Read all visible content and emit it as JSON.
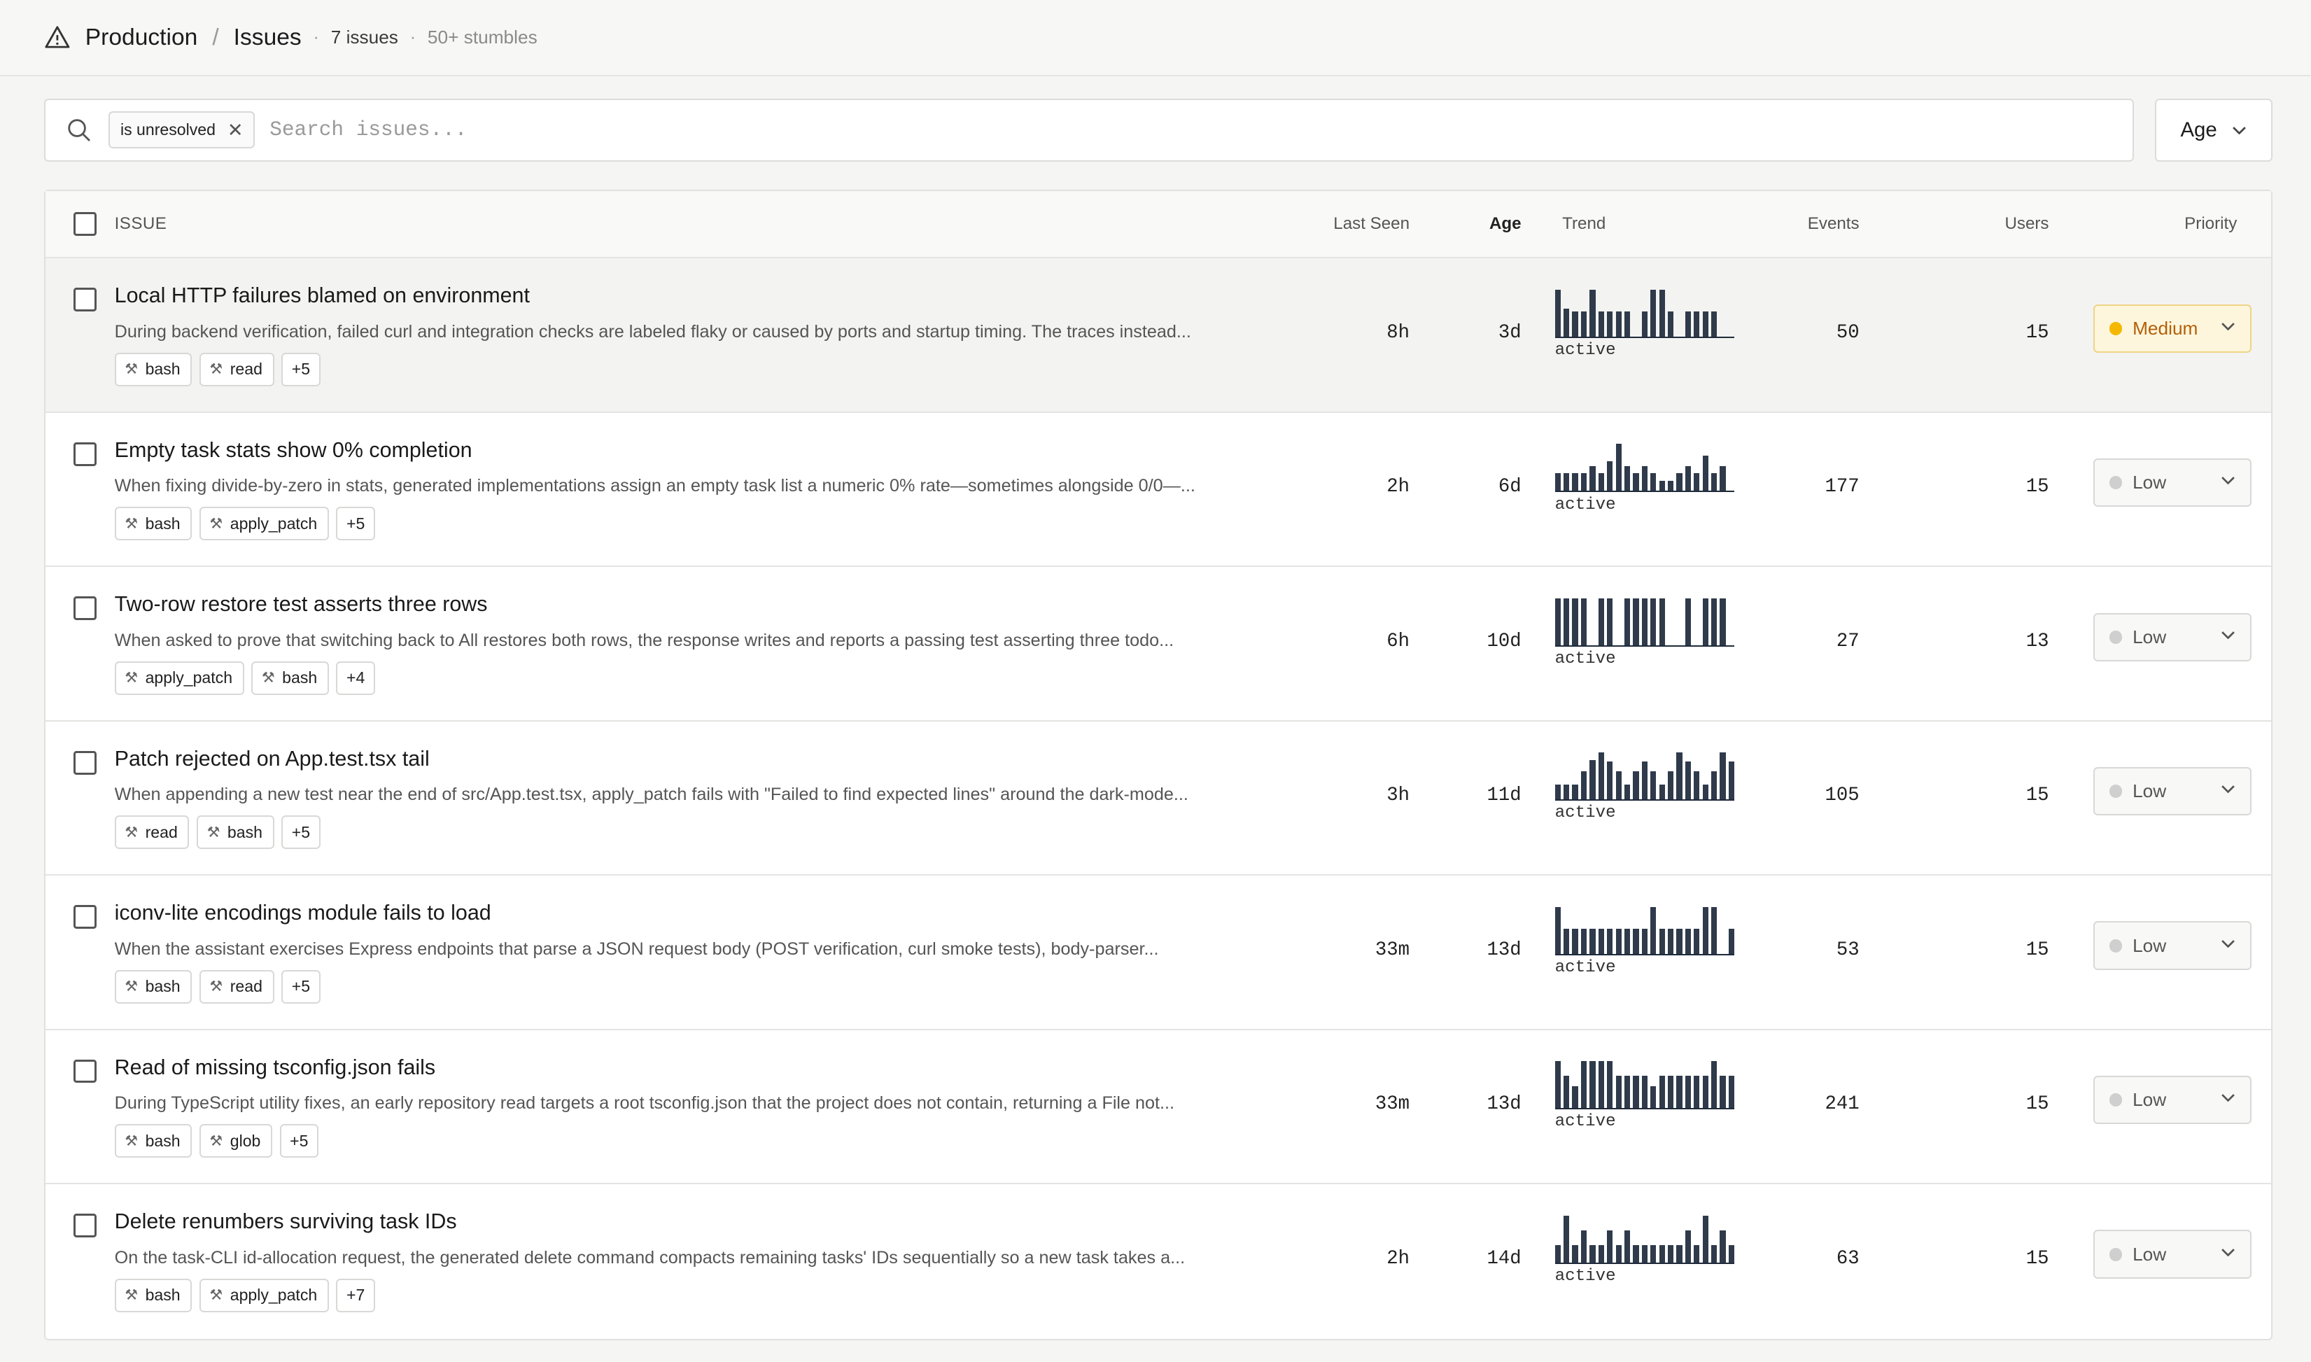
{
  "header": {
    "project": "Production",
    "section": "Issues",
    "count": "7 issues",
    "stumbles": "50+ stumbles"
  },
  "toolbar": {
    "filter_chip": "is unresolved",
    "search_placeholder": "Search issues...",
    "sort_label": "Age"
  },
  "columns": {
    "issue": "ISSUE",
    "last_seen": "Last Seen",
    "age": "Age",
    "trend": "Trend",
    "events": "Events",
    "users": "Users",
    "priority": "Priority"
  },
  "issues": [
    {
      "title": "Local HTTP failures blamed on environment",
      "description": "During backend verification, failed curl and integration checks are labeled flaky or caused by ports and startup timing. The traces instead...",
      "tags": [
        "bash",
        "read"
      ],
      "more": "+5",
      "last_seen": "8h",
      "age": "3d",
      "trend_label": "active",
      "trend": [
        0.95,
        0.55,
        0.5,
        0.5,
        0.95,
        0.5,
        0.5,
        0.5,
        0.5,
        0,
        0.5,
        0.95,
        0.95,
        0.5,
        0,
        0.5,
        0.5,
        0.5,
        0.5,
        0,
        0
      ],
      "events": "50",
      "users": "15",
      "priority": "Medium",
      "priority_color": "#f5b800",
      "highlight": true
    },
    {
      "title": "Empty task stats show 0% completion",
      "description": "When fixing divide-by-zero in stats, generated implementations assign an empty task list a numeric 0% rate—sometimes alongside 0/0—...",
      "tags": [
        "bash",
        "apply_patch"
      ],
      "more": "+5",
      "last_seen": "2h",
      "age": "6d",
      "trend_label": "active",
      "trend": [
        0.35,
        0.35,
        0.35,
        0.35,
        0.5,
        0.35,
        0.6,
        0.95,
        0.5,
        0.35,
        0.5,
        0.35,
        0.2,
        0.2,
        0.35,
        0.5,
        0.35,
        0.7,
        0.35,
        0.5,
        0
      ],
      "events": "177",
      "users": "15",
      "priority": "Low",
      "priority_color": "#cfcfcf",
      "highlight": false
    },
    {
      "title": "Two-row restore test asserts three rows",
      "description": "When asked to prove that switching back to All restores both rows, the response writes and reports a passing test asserting three todo...",
      "tags": [
        "apply_patch",
        "bash"
      ],
      "more": "+4",
      "last_seen": "6h",
      "age": "10d",
      "trend_label": "active",
      "trend": [
        0.95,
        0.95,
        0.95,
        0.95,
        0,
        0.95,
        0.95,
        0,
        0.95,
        0.95,
        0.95,
        0.95,
        0.95,
        0,
        0,
        0.95,
        0,
        0.95,
        0.95,
        0.95,
        0
      ],
      "events": "27",
      "users": "13",
      "priority": "Low",
      "priority_color": "#cfcfcf",
      "highlight": false
    },
    {
      "title": "Patch rejected on App.test.tsx tail",
      "description": "When appending a new test near the end of src/App.test.tsx, apply_patch fails with \"Failed to find expected lines\" around the dark-mode...",
      "tags": [
        "read",
        "bash"
      ],
      "more": "+5",
      "last_seen": "3h",
      "age": "11d",
      "trend_label": "active",
      "trend": [
        0.3,
        0.3,
        0.3,
        0.55,
        0.8,
        0.95,
        0.75,
        0.55,
        0.3,
        0.55,
        0.75,
        0.55,
        0.3,
        0.55,
        0.95,
        0.75,
        0.55,
        0.3,
        0.55,
        0.95,
        0.75
      ],
      "events": "105",
      "users": "15",
      "priority": "Low",
      "priority_color": "#cfcfcf",
      "highlight": false
    },
    {
      "title": "iconv-lite encodings module fails to load",
      "description": "When the assistant exercises Express endpoints that parse a JSON request body (POST verification, curl smoke tests), body-parser...",
      "tags": [
        "bash",
        "read"
      ],
      "more": "+5",
      "last_seen": "33m",
      "age": "13d",
      "trend_label": "active",
      "trend": [
        0.95,
        0.5,
        0.5,
        0.5,
        0.5,
        0.5,
        0.5,
        0.5,
        0.5,
        0.5,
        0.5,
        0.95,
        0.5,
        0.5,
        0.5,
        0.5,
        0.5,
        0.95,
        0.95,
        0,
        0.5
      ],
      "events": "53",
      "users": "15",
      "priority": "Low",
      "priority_color": "#cfcfcf",
      "highlight": false
    },
    {
      "title": "Read of missing tsconfig.json fails",
      "description": "During TypeScript utility fixes, an early repository read targets a root tsconfig.json that the project does not contain, returning a File not...",
      "tags": [
        "bash",
        "glob"
      ],
      "more": "+5",
      "last_seen": "33m",
      "age": "13d",
      "trend_label": "active",
      "trend": [
        0.95,
        0.65,
        0.45,
        0.95,
        0.95,
        0.95,
        0.95,
        0.65,
        0.65,
        0.65,
        0.65,
        0.45,
        0.65,
        0.65,
        0.65,
        0.65,
        0.65,
        0.65,
        0.95,
        0.65,
        0.65
      ],
      "events": "241",
      "users": "15",
      "priority": "Low",
      "priority_color": "#cfcfcf",
      "highlight": false
    },
    {
      "title": "Delete renumbers surviving task IDs",
      "description": "On the task-CLI id-allocation request, the generated delete command compacts remaining tasks' IDs sequentially so a new task takes a...",
      "tags": [
        "bash",
        "apply_patch"
      ],
      "more": "+7",
      "last_seen": "2h",
      "age": "14d",
      "trend_label": "active",
      "trend": [
        0.35,
        0.95,
        0.35,
        0.65,
        0.35,
        0.35,
        0.65,
        0.35,
        0.65,
        0.35,
        0.35,
        0.35,
        0.35,
        0.35,
        0.35,
        0.65,
        0.35,
        0.95,
        0.35,
        0.65,
        0.35
      ],
      "events": "63",
      "users": "15",
      "priority": "Low",
      "priority_color": "#cfcfcf",
      "highlight": false
    }
  ]
}
